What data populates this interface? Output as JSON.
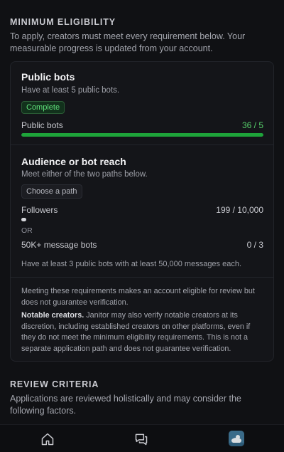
{
  "eligibility": {
    "title": "MINIMUM ELIGIBILITY",
    "description": "To apply, creators must meet every requirement below. Your measurable progress is updated from your account.",
    "public_bots": {
      "title": "Public bots",
      "subtitle": "Have at least 5 public bots.",
      "badge": "Complete",
      "metric_label": "Public bots",
      "metric_value": "36 / 5",
      "progress_fraction": 1.0
    },
    "audience": {
      "title": "Audience or bot reach",
      "subtitle": "Meet either of the two paths below.",
      "chip": "Choose a path",
      "followers_label": "Followers",
      "followers_value": "199 / 10,000",
      "followers_fraction": 0.0199,
      "or_label": "OR",
      "message_bots_label": "50K+ message bots",
      "message_bots_value": "0 / 3",
      "message_bots_desc": "Have at least 3 public bots with at least 50,000 messages each."
    },
    "note_1": "Meeting these requirements makes an account eligible for review but does not guarantee verification.",
    "note_2_bold": "Notable creators.",
    "note_2": " Janitor may also verify notable creators at its discretion, including established creators on other platforms, even if they do not meet the minimum eligibility requirements. This is not a separate application path and does not guarantee verification."
  },
  "review": {
    "title": "REVIEW CRITERIA",
    "description": "Applications are reviewed holistically and may consider the following factors."
  },
  "bottom_nav": {
    "icons": [
      "home-icon",
      "chat-icon",
      "avatar"
    ]
  },
  "colors": {
    "accent_green": "#1ea43a",
    "complete_text": "#5fe07a"
  }
}
